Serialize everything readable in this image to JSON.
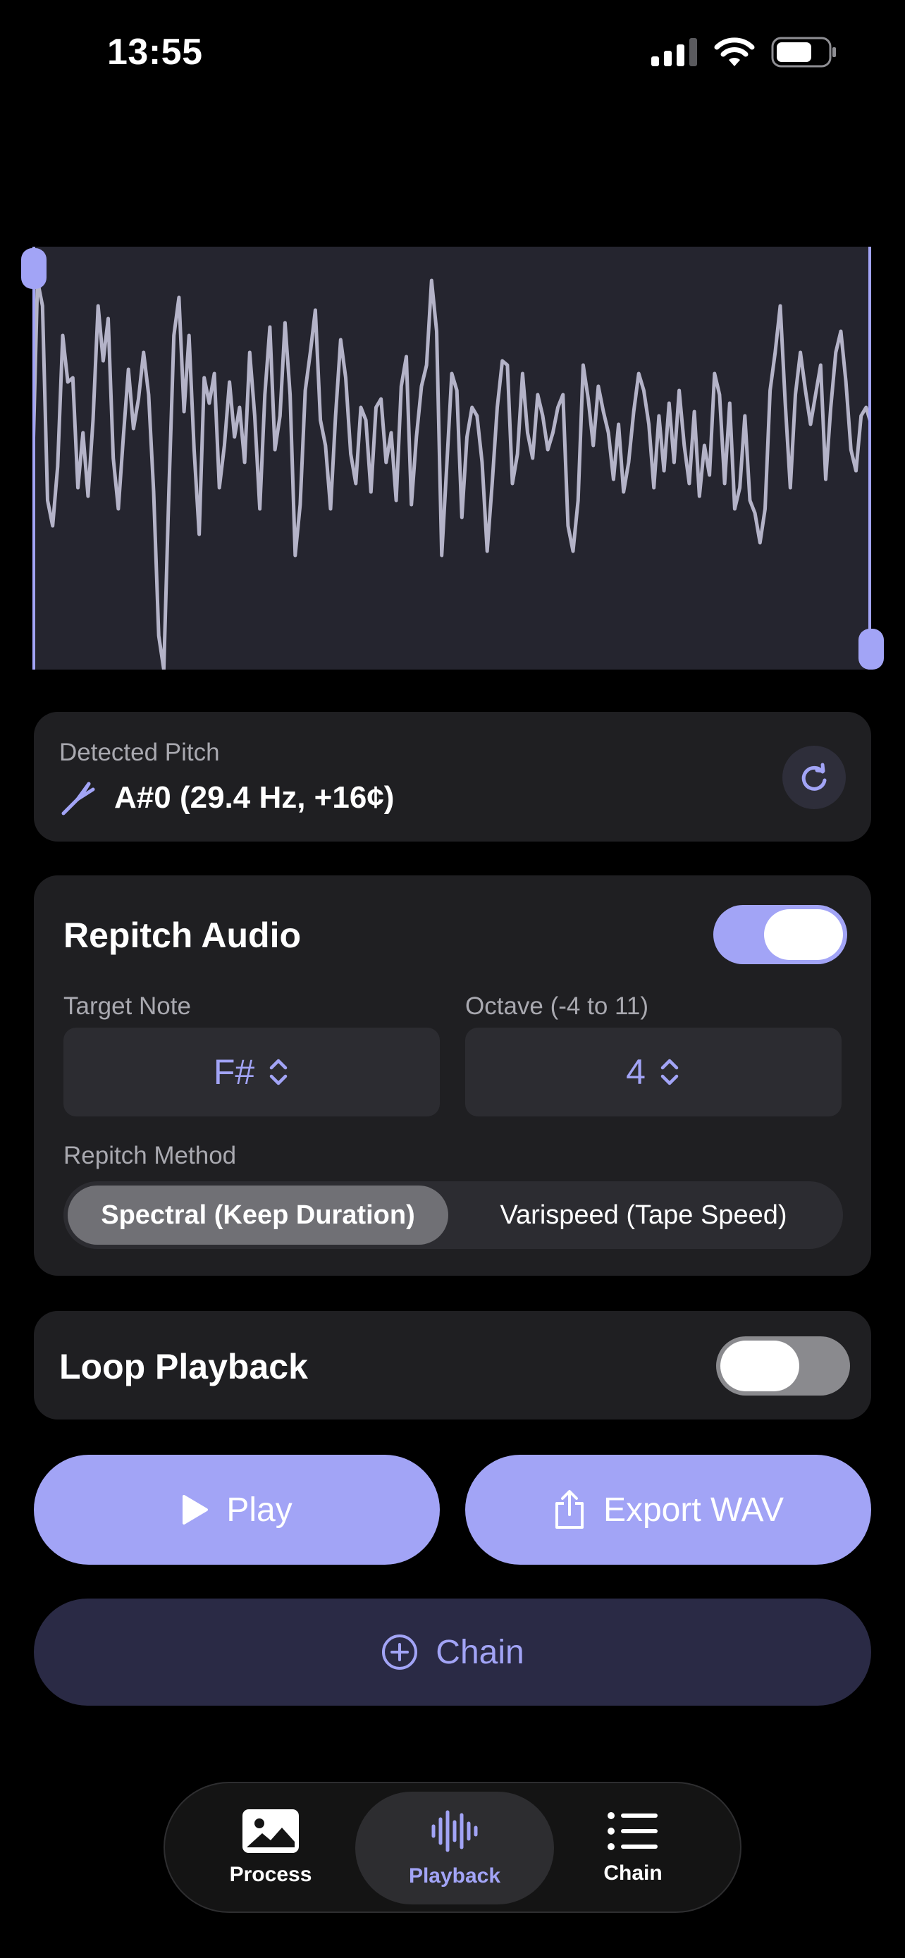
{
  "status_bar": {
    "time": "13:55",
    "battery_level": 0.7
  },
  "detected_pitch": {
    "label": "Detected Pitch",
    "value": "A#0 (29.4 Hz, +16¢)",
    "icon": "tuning-fork-icon",
    "refresh_icon": "refresh-icon"
  },
  "repitch": {
    "title": "Repitch Audio",
    "enabled": true,
    "target_note_label": "Target Note",
    "target_note_value": "F#",
    "octave_label": "Octave (-4 to 11)",
    "octave_value": "4",
    "method_label": "Repitch Method",
    "methods": [
      "Spectral (Keep Duration)",
      "Varispeed (Tape Speed)"
    ],
    "selected_method": "Spectral (Keep Duration)"
  },
  "loop": {
    "title": "Loop Playback",
    "enabled": false
  },
  "actions": {
    "play_label": "Play",
    "export_label": "Export WAV",
    "chain_label": "Chain"
  },
  "tabs": [
    {
      "label": "Process",
      "icon": "photo-icon",
      "active": false
    },
    {
      "label": "Playback",
      "icon": "waveform-icon",
      "active": true
    },
    {
      "label": "Chain",
      "icon": "list-icon",
      "active": false
    }
  ],
  "colors": {
    "accent": "#a2a4f6",
    "background": "#000000",
    "card": "#1f1f22",
    "waveform_bg": "#25252f",
    "waveform_line": "#b4b3c8",
    "chain_button_bg": "#2a2a45"
  }
}
